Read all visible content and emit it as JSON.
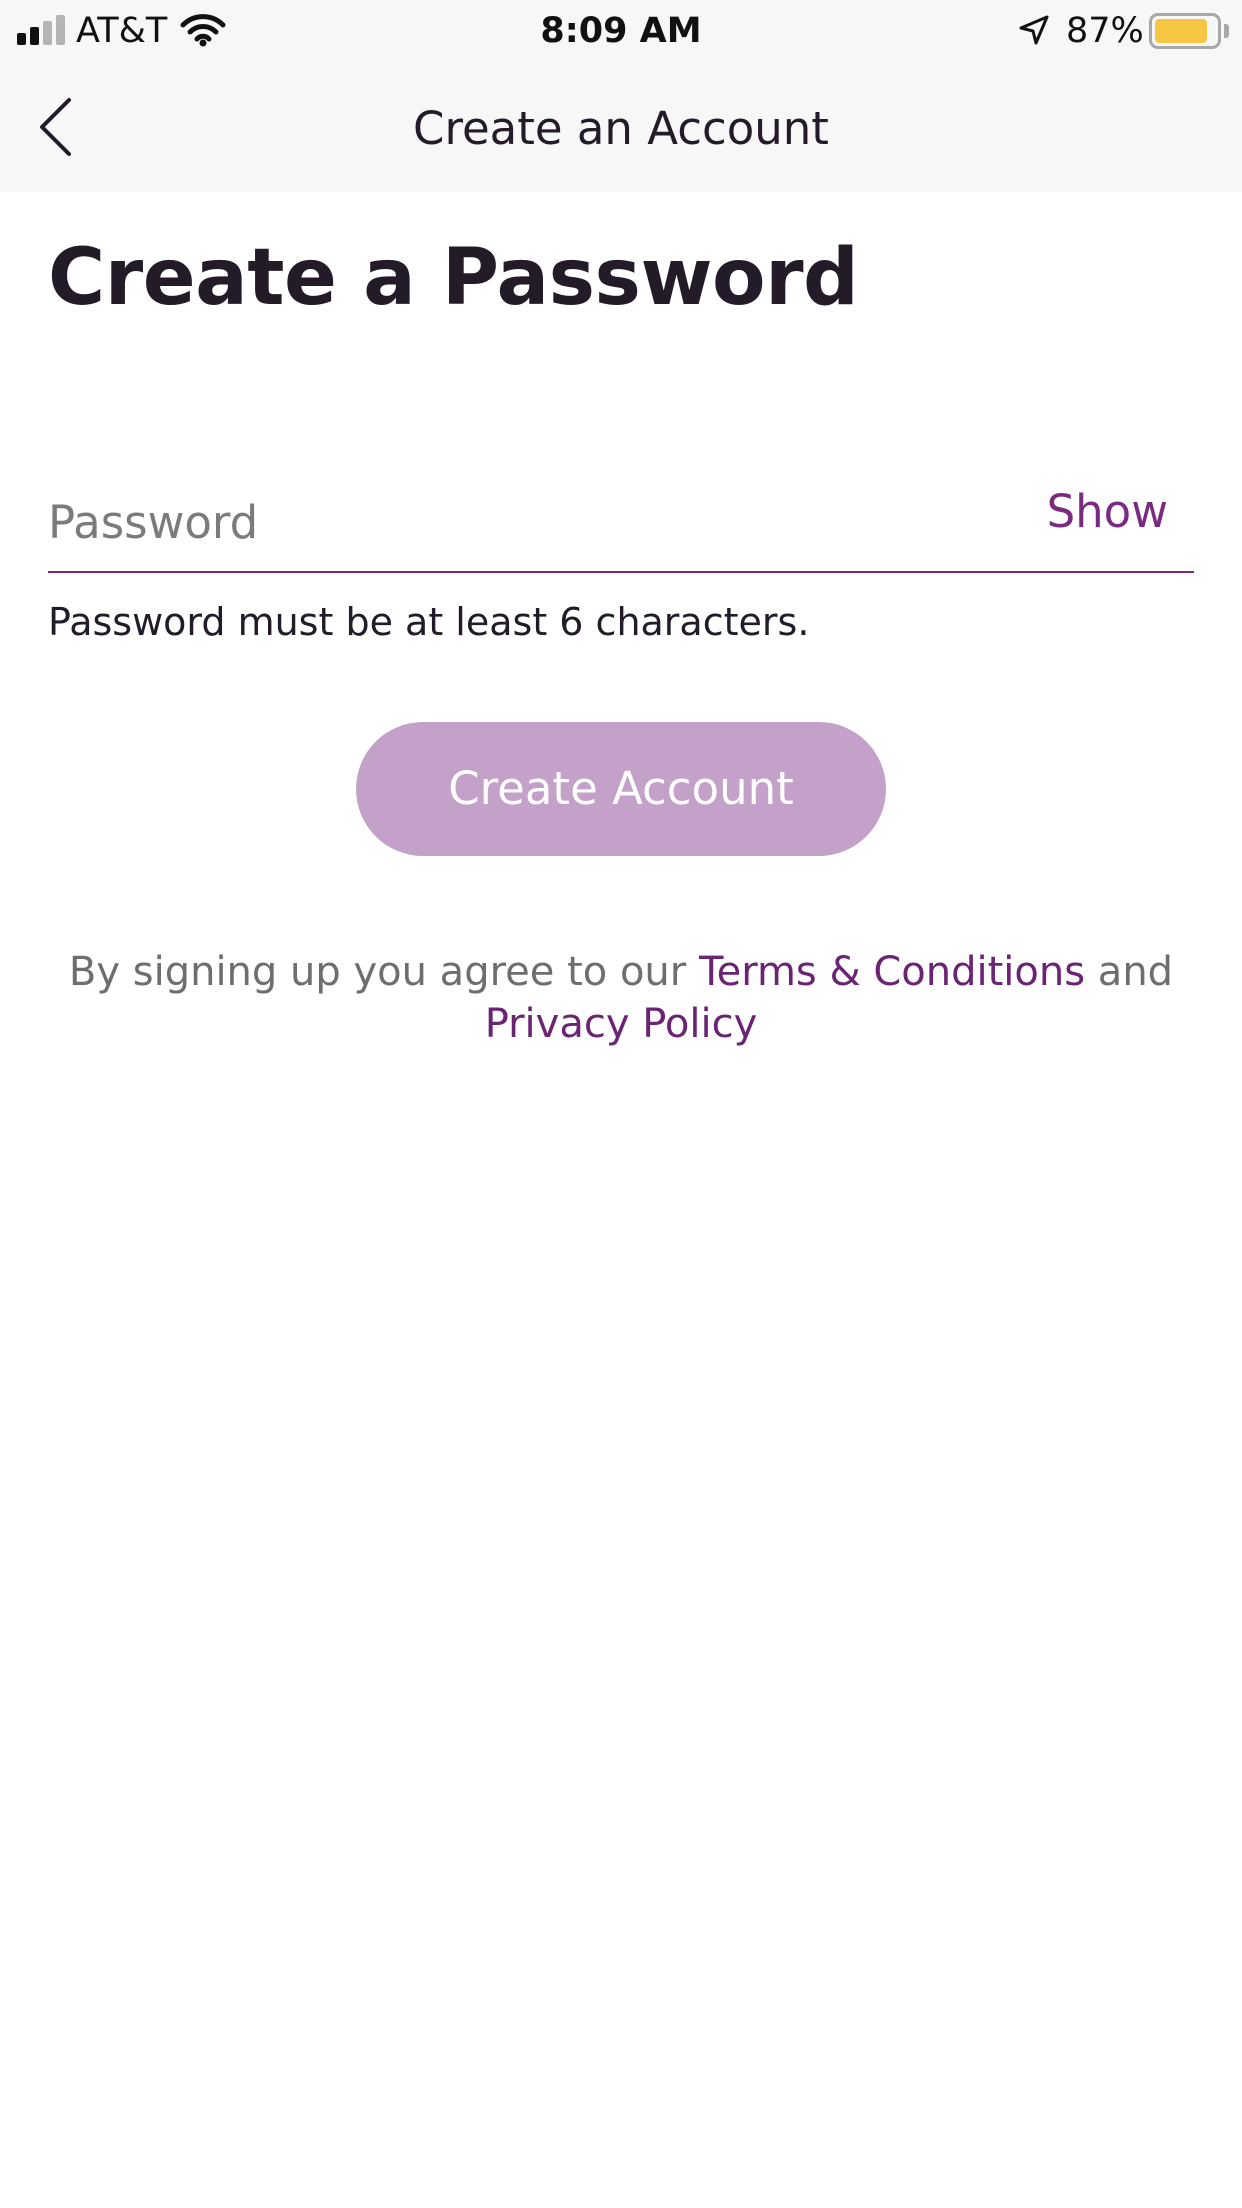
{
  "status_bar": {
    "carrier": "AT&T",
    "time": "8:09 AM",
    "battery_percent_label": "87%",
    "battery_level": 0.87,
    "signal_bars_filled": 2,
    "signal_bars_total": 4,
    "icons": [
      "signal-icon",
      "wifi-icon",
      "location-arrow-icon",
      "battery-icon"
    ]
  },
  "nav": {
    "title": "Create an Account",
    "back_icon": "chevron-left-icon"
  },
  "main": {
    "heading": "Create a Password",
    "password_field": {
      "value": "",
      "placeholder": "Password",
      "toggle_label": "Show"
    },
    "helper_text": "Password must be at least 6 characters.",
    "submit_label": "Create Account",
    "legal": {
      "prefix": "By signing up you agree to our ",
      "terms_link": "Terms & Conditions",
      "joiner": " and",
      "privacy_link": "Privacy Policy"
    }
  },
  "colors": {
    "accent": "#7a2a80",
    "link": "#6b2474",
    "button_disabled": "#c3a1c8",
    "heading_text": "#231b27",
    "muted_text": "#6e6e6e",
    "bar_background": "#f7f7f7",
    "battery_fill": "#f7c744"
  }
}
